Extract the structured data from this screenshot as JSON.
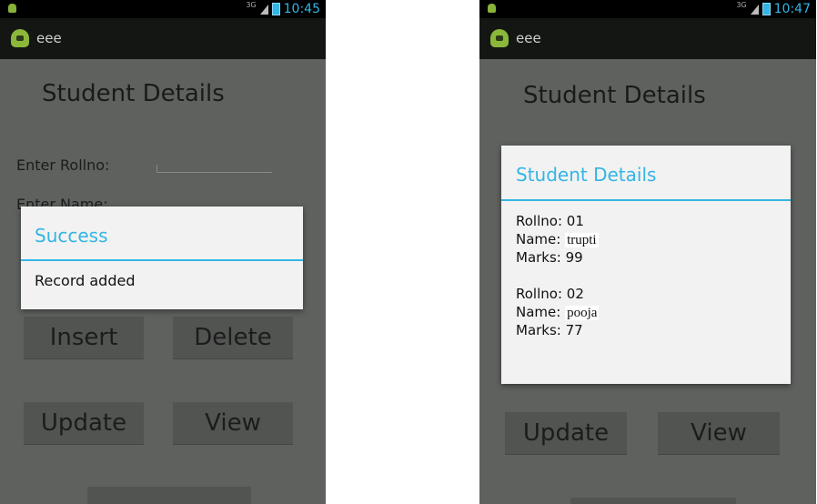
{
  "left": {
    "status_time": "10:45",
    "status_net": "3G",
    "app_title": "eee",
    "heading": "Student Details",
    "rollno_label": "Enter Rollno:",
    "name_label": "Enter Name:",
    "buttons": {
      "insert": "Insert",
      "delete": "Delete",
      "update": "Update",
      "view": "View"
    },
    "dialog": {
      "title": "Success",
      "message": "Record added"
    }
  },
  "right": {
    "status_time": "10:47",
    "status_net": "3G",
    "app_title": "eee",
    "heading": "Student Details",
    "buttons": {
      "update": "Update",
      "view": "View"
    },
    "dialog": {
      "title": "Student Details",
      "rollno_prefix": "Rollno:",
      "name_prefix": "Name:",
      "marks_prefix": "Marks:",
      "records": [
        {
          "rollno": "01",
          "name": "trupti",
          "marks": "99"
        },
        {
          "rollno": "02",
          "name": "pooja",
          "marks": "77"
        }
      ]
    }
  }
}
